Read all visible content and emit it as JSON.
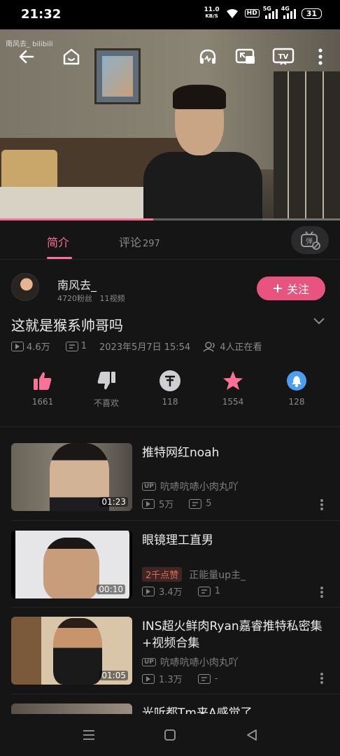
{
  "status_bar": {
    "time": "21:32",
    "net_speed_top": "11.0",
    "net_speed_bottom": "KB/S",
    "hd": "HD",
    "sig1": "5G",
    "sig2": "4G",
    "battery": "31"
  },
  "video": {
    "watermark": "南风去_ bilibili",
    "progress": 0.45
  },
  "tabs": {
    "intro": "简介",
    "comments": "评论",
    "comments_count": "297",
    "danmaku_label": "弹"
  },
  "author": {
    "name": "南风去_",
    "fans": "4720粉丝",
    "videos": "11视频",
    "follow": "关注"
  },
  "video_info": {
    "title": "这就是猴系帅哥吗",
    "views": "4.6万",
    "danmaku": "1",
    "date": "2023年5月7日 15:54",
    "watching": "4人正在看"
  },
  "actions": [
    {
      "label": "1661",
      "icon": "thumbs-up-icon"
    },
    {
      "label": "不喜欢",
      "icon": "thumbs-down-icon"
    },
    {
      "label": "118",
      "icon": "coin-icon"
    },
    {
      "label": "1554",
      "icon": "star-icon"
    },
    {
      "label": "128",
      "icon": "share-icon"
    }
  ],
  "related": [
    {
      "title": "推特网红noah",
      "up": "吭哧吭哧小肉丸吖",
      "badge": "",
      "views": "5万",
      "danmaku": "5",
      "duration": "01:23"
    },
    {
      "title": "眼镜理工直男",
      "up": "正能量up主_",
      "badge": "2千点赞",
      "views": "3.4万",
      "danmaku": "1",
      "duration": "00:10"
    },
    {
      "title": "INS超火鲜肉Ryan嘉睿推特私密集+视频合集",
      "up": "吭哧吭哧小肉丸吖",
      "badge": "",
      "views": "1.3万",
      "danmaku": "-",
      "duration": "01:05"
    },
    {
      "title": "光听都Tm来A感觉了"
    }
  ],
  "colors": {
    "accent": "#fb7299",
    "follow_bg": "#e8547f",
    "share": "#4a9ff0"
  }
}
